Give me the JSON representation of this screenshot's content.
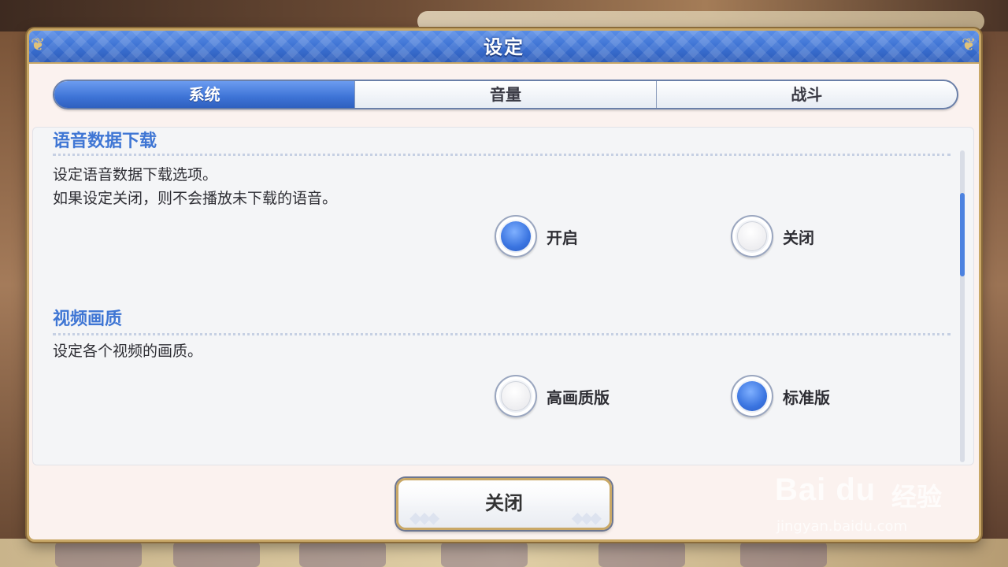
{
  "dialog": {
    "title": "设定",
    "corner_glyph": "❦"
  },
  "tabs": [
    {
      "label": "系统",
      "active": true
    },
    {
      "label": "音量",
      "active": false
    },
    {
      "label": "战斗",
      "active": false
    }
  ],
  "sections": {
    "voice": {
      "title": "语音数据下载",
      "desc_line1": "设定语音数据下载选项。",
      "desc_line2": "如果设定关闭，则不会播放未下载的语音。",
      "option_on": "开启",
      "option_off": "关闭",
      "selected": "开启"
    },
    "video": {
      "title": "视频画质",
      "desc_line1": "设定各个视频的画质。",
      "option_high": "高画质版",
      "option_standard": "标准版",
      "selected": "标准版"
    }
  },
  "close_button": {
    "label": "关闭",
    "deco": "◆◆◆"
  },
  "watermark": {
    "logo": "Bai du",
    "jingyan": "经验",
    "url": "jingyan.baidu.com"
  },
  "colors": {
    "accent_blue": "#3d73d6",
    "section_title": "#3f76d4",
    "gold_border": "#c9a867"
  }
}
